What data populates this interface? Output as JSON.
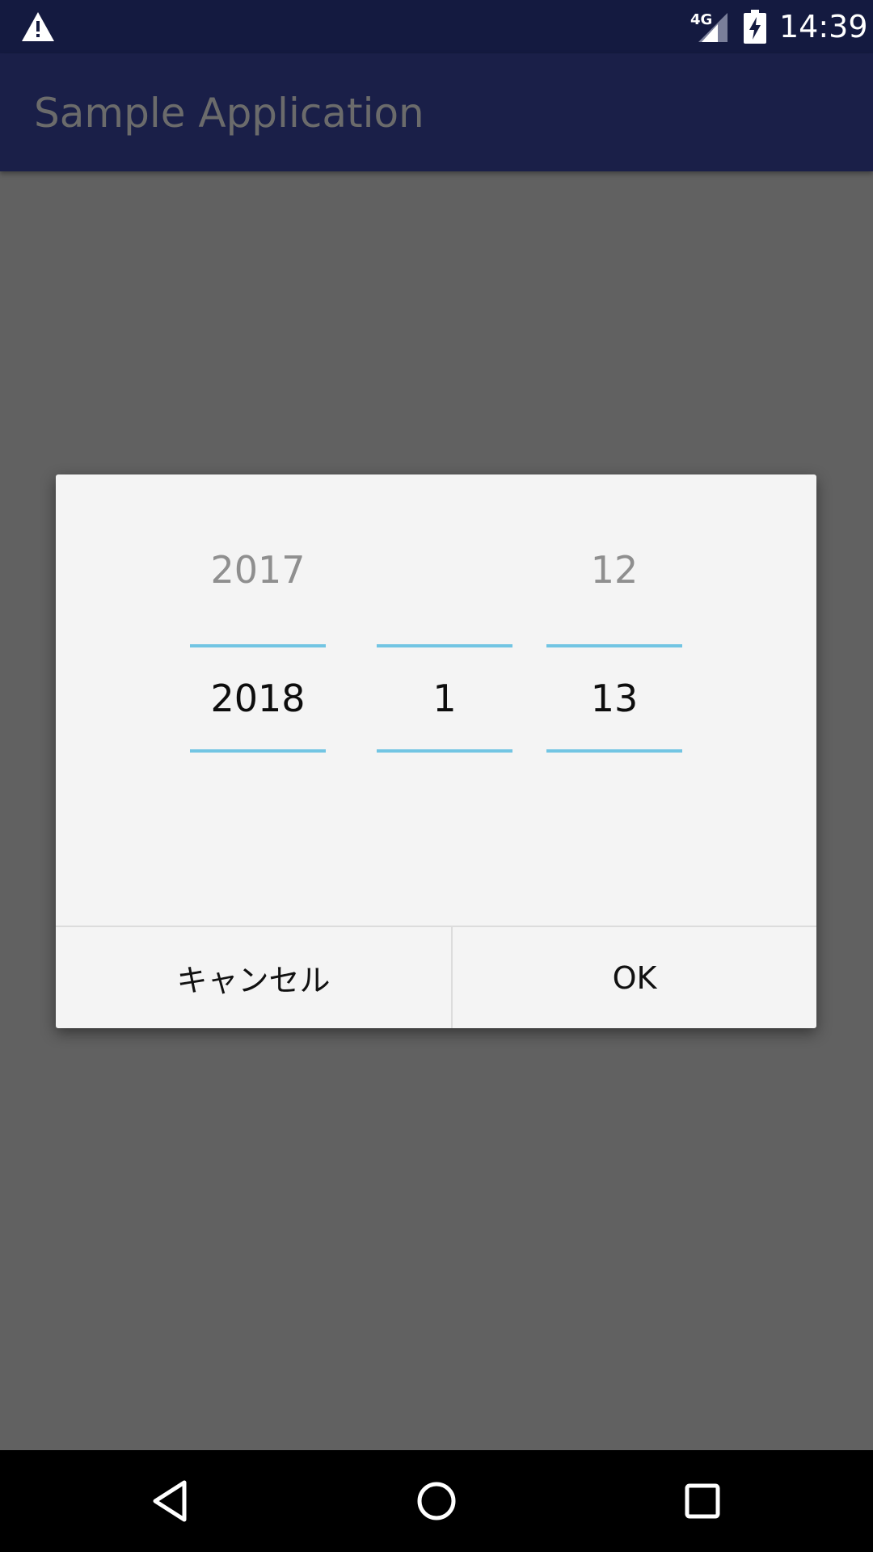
{
  "status_bar": {
    "time": "14:39",
    "network": "4G",
    "icons": [
      "warning-icon",
      "signal-icon",
      "battery-charging-icon"
    ]
  },
  "app_bar": {
    "title": "Sample Application"
  },
  "date_picker": {
    "year": {
      "previous": "2017",
      "current": "2018"
    },
    "month": {
      "previous": "",
      "current": "1"
    },
    "day": {
      "previous": "12",
      "current": "13"
    },
    "accent_color": "#72c5e3"
  },
  "dialog_buttons": {
    "cancel_label": "キャンセル",
    "ok_label": "OK"
  },
  "nav_bar": {
    "icons": [
      "back-icon",
      "home-icon",
      "recents-icon"
    ]
  },
  "colors": {
    "status_bar": "#141a40",
    "app_bar": "#1a1f48",
    "scrim": "#616161",
    "dialog": "#f4f4f4"
  }
}
